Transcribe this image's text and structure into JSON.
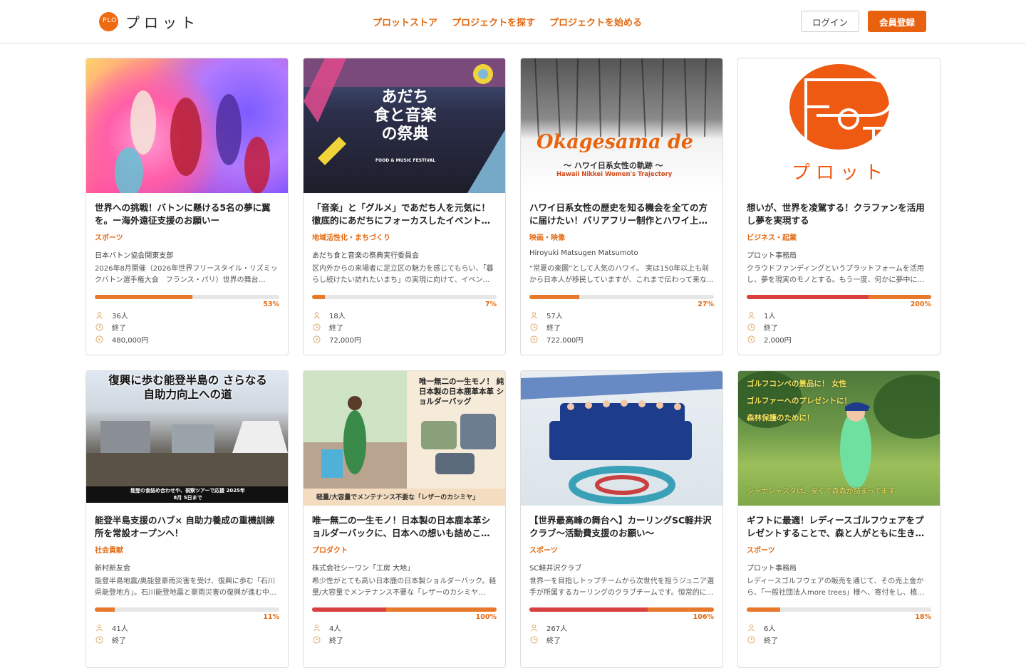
{
  "header": {
    "logo_text": "プロット",
    "logo_mark": "PLOT",
    "nav": [
      "プロットストア",
      "プロジェクトを探す",
      "プロジェクトを始める"
    ],
    "login_label": "ログイン",
    "register_label": "会員登録"
  },
  "colors": {
    "accent": "#e8610e",
    "progress": "#e8782a",
    "over": "#d94040"
  },
  "icons": {
    "supporters": "person-icon",
    "status": "clock-icon",
    "amount": "yen-icon"
  },
  "cards": [
    {
      "thumb_text": "",
      "title": "世界への挑戦！バトンに懸ける5名の夢に翼を。ー海外遠征支援のお願いー",
      "category": "スポーツ",
      "owner": "日本バトン協会関東支部",
      "desc": "2026年8月開催（2026年世界フリースタイル・リズミックバトン選手権大会　フランス・パリ）世界の舞台…",
      "progress": 0.53,
      "percent": "53%",
      "supporters": "36人",
      "status": "終了",
      "amount": "480,000円"
    },
    {
      "thumb_text": "あだち 食と音楽の祭典",
      "thumb_sub": "FOOD & MUSIC FESTIVAL",
      "title": "「音楽」と「グルメ」であだち人を元気に！徹底的にあだちにフォーカスしたイベント開催へ",
      "category": "地域活性化・まちづくり",
      "owner": "あだち食と音楽の祭典実行委員会",
      "desc": "区内外からの来場者に足立区の魅力を感じてもらい、「暮らし続けたい訪れたいまち」の実現に向けて、イベン…",
      "progress": 0.07,
      "percent": "7%",
      "supporters": "18人",
      "status": "終了",
      "amount": "72,000円"
    },
    {
      "thumb_text": "Okagesama de",
      "thumb_sub": "〜 ハワイ日系女性の軌跡 〜",
      "thumb_sub2": "Hawaii Nikkei Women's Trajectory",
      "title": "ハワイ日系女性の歴史を知る機会を全ての方に届けたい！バリアフリー制作とハワイ上映交…",
      "category": "映画・映像",
      "owner": "Hiroyuki Matsugen Matsumoto",
      "desc": "“常夏の楽園”として人気のハワイ。 実は150年以上も前から日本人が移民していますが、これまで伝わって来なか…",
      "progress": 0.27,
      "percent": "27%",
      "supporters": "57人",
      "status": "終了",
      "amount": "722,000円"
    },
    {
      "thumb_text": "プロット",
      "title": "想いが、世界を凌駕する！クラファンを活用し夢を実現する",
      "category": "ビジネス・起業",
      "owner": "プロット事務局",
      "desc": "クラウドファンディングというプラットフォームを活用し、夢を現実のモノとする。もう一度、何かに夢中に…",
      "progress": 1.0,
      "over": 0.66,
      "percent": "200%",
      "supporters": "1人",
      "status": "終了",
      "amount": "2,000円"
    },
    {
      "thumb_text": "復興に歩む能登半島の さらなる自助力向上への道",
      "thumb_sub": "能登の食詰め合わせや、視察ツアーで応援 2025年 8月 5日まで",
      "title": "能登半島支援のハブ× 自助力養成の重機訓練所を常設オープンへ！",
      "category": "社会貢献",
      "owner": "新村新友会",
      "desc": "能登半島地震/奥能登豪雨災害を受け、復興に歩む「石川県能登地方」。石川能登地震と豪雨災害の復興が進む中…",
      "progress": 0.11,
      "percent": "11%",
      "supporters": "41人",
      "status": "終了",
      "amount": ""
    },
    {
      "thumb_text": "唯一無二の一生モノ！ 純日本製の日本鹿革本革 ショルダーバッグ",
      "thumb_sub": "軽量/大容量でメンテナンス不要な「レザーのカシミヤ」",
      "title": "唯一無二の一生モノ！日本製の日本鹿本革ショルダーバックに、日本への想いも詰めこんで…",
      "category": "プロダクト",
      "owner": "株式会社シーワン「工房 大地」",
      "desc": "希少性がとても高い日本鹿の日本製ショルダーバック。軽量/大容量でメンテナンス不要な「レザーのカシミヤ…",
      "progress": 1.0,
      "over": 0.4,
      "percent": "100%",
      "supporters": "4人",
      "status": "終了",
      "amount": ""
    },
    {
      "thumb_text": "",
      "title": "【世界最高峰の舞台へ】カーリングSC軽井沢クラブ〜活動費支援のお願い〜",
      "category": "スポーツ",
      "owner": "SC軽井沢クラブ",
      "desc": "世界一を目指しトップチームから次世代を担うジュニア選手が所属するカーリングのクラブチームです。恒常的に…",
      "progress": 1.0,
      "over": 0.64,
      "percent": "106%",
      "supporters": "267人",
      "status": "終了",
      "amount": ""
    },
    {
      "thumb_text": "ゴルフコンペの景品に！ 女性ゴルファーへのプレゼントに！ 森林保護のために！",
      "thumb_sub": "シャナシャスタは、安くて森森が詰まってます",
      "title": "ギフトに最適！レディースゴルフウェアをプレゼントすることで、森と人がともに生きられ…",
      "category": "スポーツ",
      "owner": "プロット事務局",
      "desc": "レディースゴルフウェアの販売を通じて、その売上金から、「一般社団法人more trees」様へ、寄付をし、植林…",
      "progress": 0.18,
      "percent": "18%",
      "supporters": "6人",
      "status": "終了",
      "amount": ""
    }
  ]
}
